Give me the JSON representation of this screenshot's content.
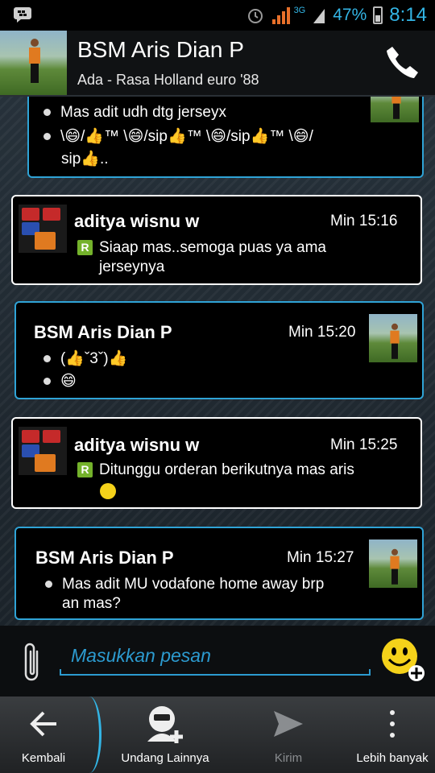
{
  "status": {
    "battery": "47%",
    "time": "8:14",
    "network": "3G"
  },
  "header": {
    "title": "BSM Aris Dian P",
    "subtitle": "Ada - Rasa Holland euro '88"
  },
  "messages": [
    {
      "lines": [
        "Mas adit udh dtg jerseyx",
        "\\😄/👍™ \\😄/sip👍™ \\😄/sip👍™ \\😄/",
        "sip👍.."
      ]
    },
    {
      "name": "aditya wisnu w",
      "time": "Min 15:16",
      "text": "Siaap mas..semoga puas ya ama",
      "text2": "jerseynya"
    },
    {
      "name": "BSM Aris Dian P",
      "time": "Min 15:20",
      "line1": "(👍ˇ3ˇ)👍",
      "line2": "😄"
    },
    {
      "name": "aditya wisnu w",
      "time": "Min 15:25",
      "text": "Ditunggu orderan berikutnya mas aris"
    },
    {
      "name": "BSM Aris Dian P",
      "time": "Min 15:27",
      "text": "Mas adit MU vodafone home away brp",
      "text2": "an mas?"
    }
  ],
  "input": {
    "placeholder": "Masukkan pesan"
  },
  "actions": {
    "back": "Kembali",
    "invite": "Undang Lainnya",
    "send": "Kirim",
    "more": "Lebih banyak"
  },
  "colors": {
    "accent": "#2c9bd0",
    "incoming_border": "#2fa3d6",
    "outgoing_border": "#ffffff"
  }
}
